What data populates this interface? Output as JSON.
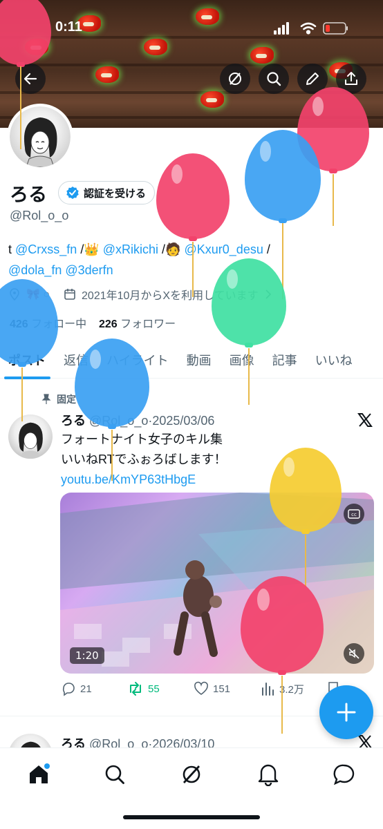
{
  "status": {
    "time": "0:11"
  },
  "header": {
    "back_icon": "arrow-left-icon",
    "grok_icon": "grok-icon",
    "search_icon": "search-icon",
    "edit_icon": "pencil-icon",
    "share_icon": "share-icon"
  },
  "profile": {
    "name": "ろる",
    "verify_label": "認証を受ける",
    "handle": "@Rol_o_o",
    "bio_prefix": "t ",
    "bio_links": [
      "@Crxss_fn",
      "@xRikichi",
      "@Kxur0_desu",
      "@dola_fn",
      "@3derfn"
    ],
    "bio_sep1": " /",
    "bio_sep2": " /",
    "bio_sep3": " /",
    "emoji_crown": "👑",
    "emoji_face": "🧑",
    "location_emojis": "🎀 ○",
    "joined": "2021年10月からXを利用しています",
    "following_count": "426",
    "following_label": "フォロー中",
    "followers_count": "226",
    "followers_label": "フォロワー"
  },
  "tabs": [
    "ポスト",
    "返信",
    "ハイライト",
    "動画",
    "画像",
    "記事",
    "いいね"
  ],
  "pinned_label": "固定",
  "posts": [
    {
      "name": "ろる",
      "handle": "@Rol_o_o",
      "date": "2025/03/06",
      "line1": "フォートナイト女子のキル集",
      "line2": "いいねRTでふぉろばします！",
      "link": "youtu.be/KmYP63tHbgE",
      "video_duration": "1:20",
      "replies": "21",
      "reposts": "55",
      "likes": "151",
      "views": "3.2万"
    },
    {
      "name": "ろる",
      "handle": "@Rol_o_o",
      "date": "2026/03/10"
    }
  ],
  "colors": {
    "accent": "#1d9bf0",
    "repost_green": "#00ba7c",
    "balloon_red": "#f2426b",
    "balloon_blue": "#3aa0f2",
    "balloon_green": "#3fe0a2",
    "balloon_yellow": "#f5cc30"
  }
}
